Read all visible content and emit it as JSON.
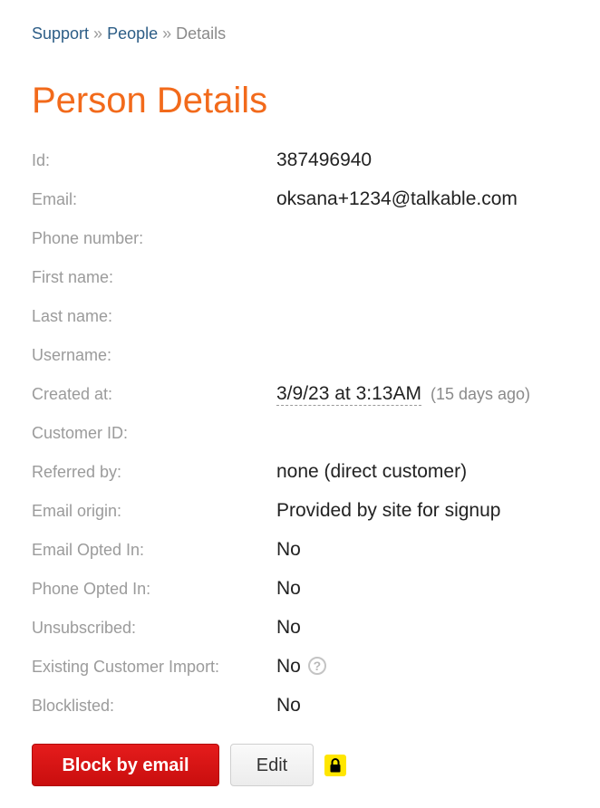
{
  "breadcrumb": {
    "items": [
      "Support",
      "People",
      "Details"
    ],
    "separator": "»"
  },
  "page": {
    "title": "Person Details"
  },
  "fields": {
    "id": {
      "label": "Id:",
      "value": "387496940"
    },
    "email": {
      "label": "Email:",
      "value": "oksana+1234@talkable.com"
    },
    "phone": {
      "label": "Phone number:",
      "value": ""
    },
    "first_name": {
      "label": "First name:",
      "value": ""
    },
    "last_name": {
      "label": "Last name:",
      "value": ""
    },
    "username": {
      "label": "Username:",
      "value": ""
    },
    "created_at": {
      "label": "Created at:",
      "value": "3/9/23 at 3:13AM",
      "ago": "(15 days ago)"
    },
    "customer_id": {
      "label": "Customer ID:",
      "value": ""
    },
    "referred_by": {
      "label": "Referred by:",
      "value": "none (direct customer)"
    },
    "email_origin": {
      "label": "Email origin:",
      "value": "Provided by site for signup"
    },
    "email_opted_in": {
      "label": "Email Opted In:",
      "value": "No"
    },
    "phone_opted_in": {
      "label": "Phone Opted In:",
      "value": "No"
    },
    "unsubscribed": {
      "label": "Unsubscribed:",
      "value": "No"
    },
    "existing_customer_import": {
      "label": "Existing Customer Import:",
      "value": "No",
      "help_icon": "question-circle-icon",
      "help_glyph": "?"
    },
    "blocklisted": {
      "label": "Blocklisted:",
      "value": "No"
    }
  },
  "actions": {
    "block_label": "Block by email",
    "edit_label": "Edit",
    "lock_icon": "lock-icon"
  },
  "colors": {
    "title": "#f26a1b",
    "link": "#2c5d86",
    "label": "#9b9b9b",
    "block_button": "#d61414",
    "lock_badge": "#ffe600"
  }
}
